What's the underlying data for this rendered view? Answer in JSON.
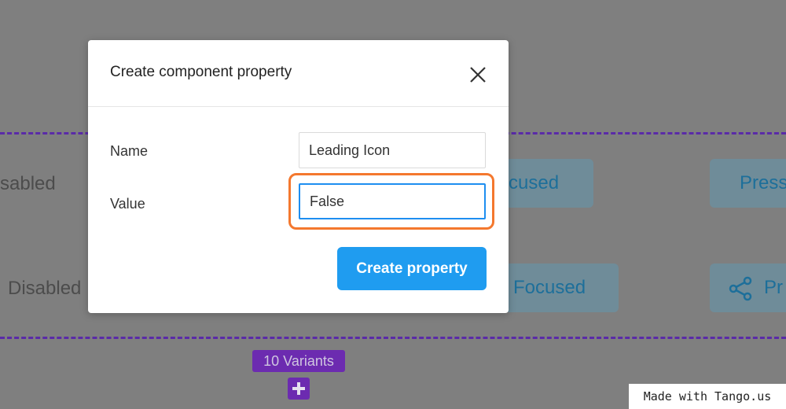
{
  "background": {
    "row1": {
      "disabled": "sabled",
      "focused": "cused",
      "pressed": "Press"
    },
    "row2": {
      "disabled": "Disabled",
      "focused": "Focused",
      "pressed": "Pr"
    },
    "variants_badge": "10 Variants"
  },
  "dialog": {
    "title": "Create component property",
    "fields": {
      "name": {
        "label": "Name",
        "value": "Leading Icon"
      },
      "value": {
        "label": "Value",
        "value": "False"
      }
    },
    "submit_label": "Create property"
  },
  "watermark": "Made with Tango.us",
  "colors": {
    "accent_blue": "#1f9cf0",
    "highlight_orange": "#f4782e",
    "component_purple": "#6c2bb0"
  }
}
